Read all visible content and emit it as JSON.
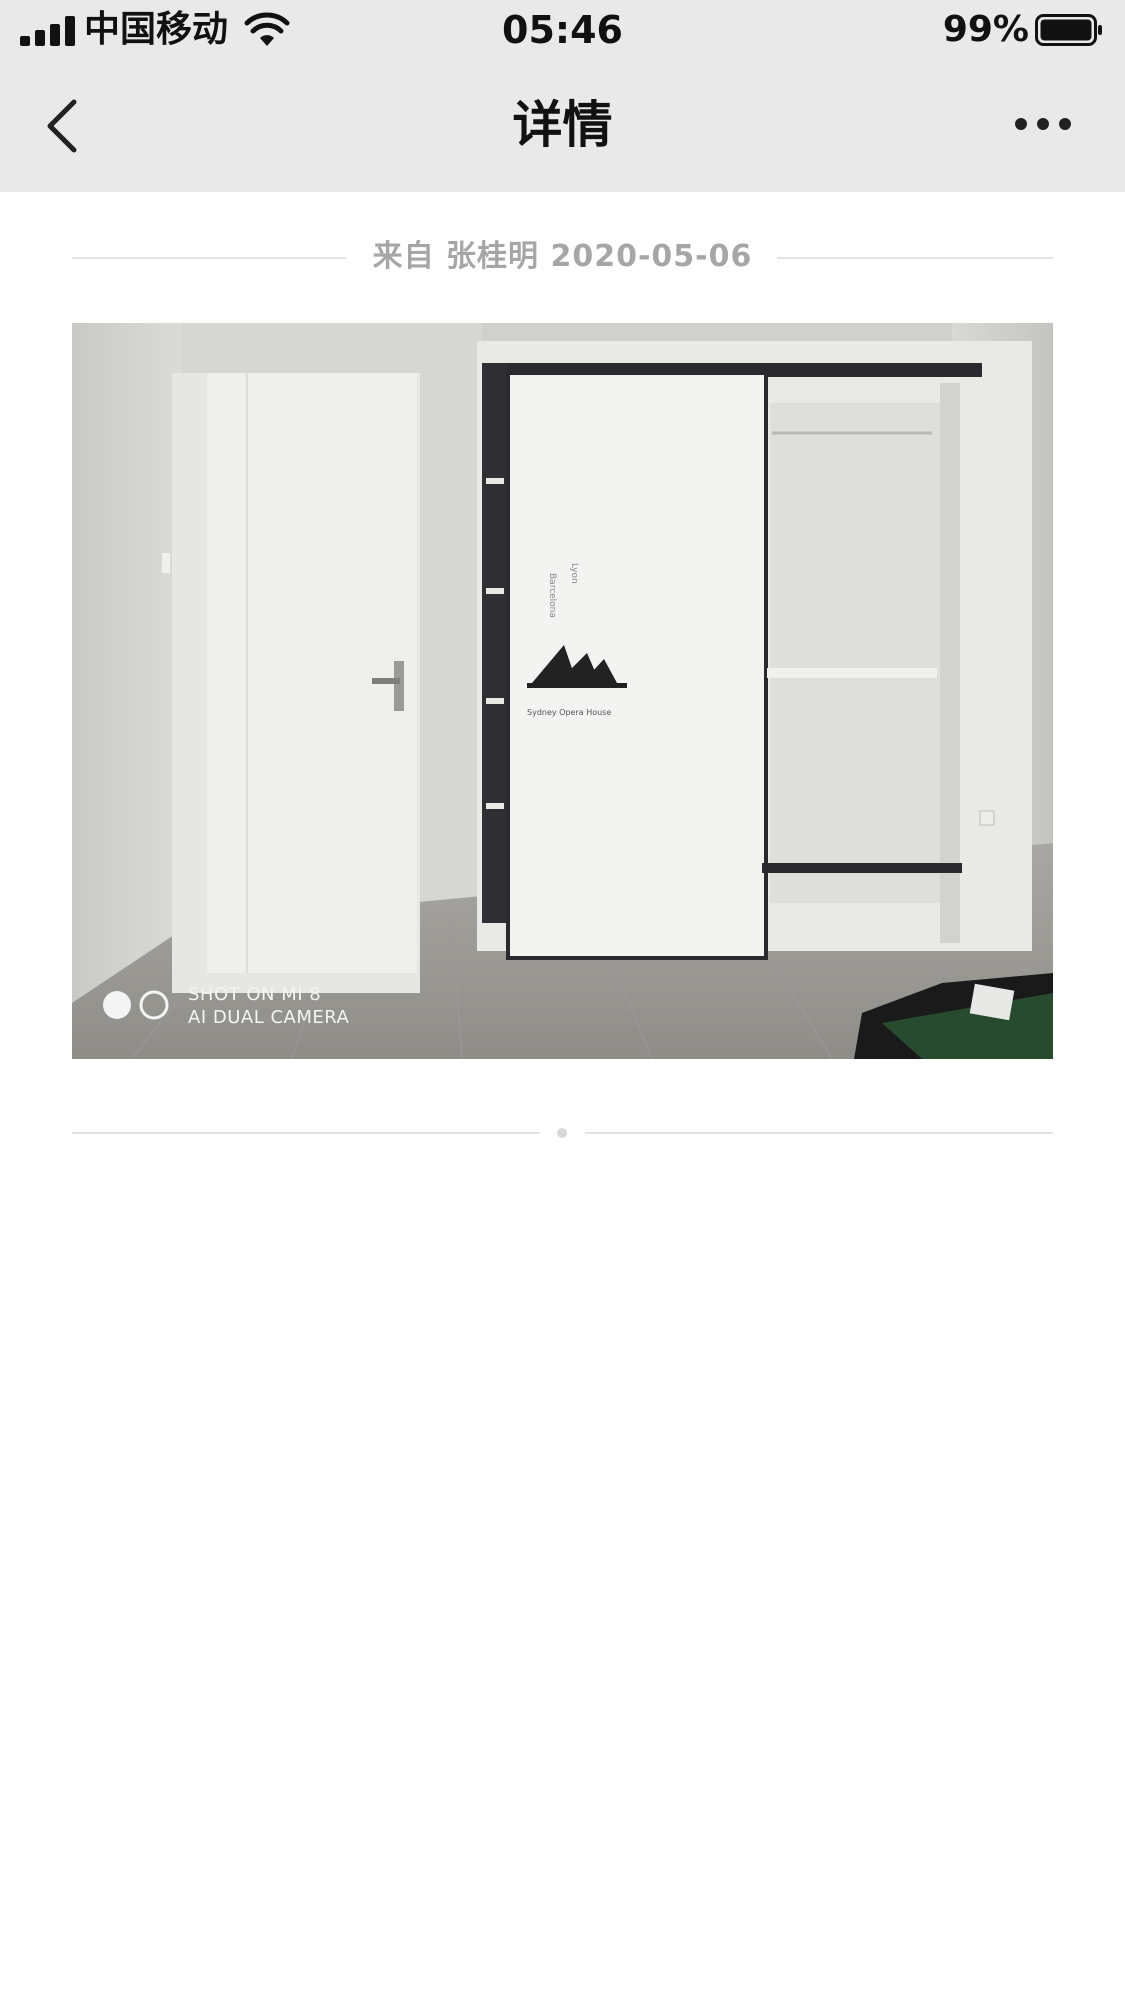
{
  "status_bar": {
    "carrier": "中国移动",
    "time": "05:46",
    "battery_percent": "99%",
    "signal_bars": 4,
    "battery_level": 0.99
  },
  "nav": {
    "title": "详情",
    "back_icon": "chevron-left-icon",
    "more_icon": "more-horizontal-icon"
  },
  "post": {
    "meta": "来自 张桂明 2020-05-06",
    "photo": {
      "watermark_line1": "SHOT ON MI 8",
      "watermark_line2": "AI DUAL CAMERA",
      "door_decal_caption": "Sydney Opera House"
    }
  },
  "colors": {
    "bar_background": "#e9e9e9",
    "meta_text": "#a6a6a6",
    "divider": "#e3e3e3"
  }
}
